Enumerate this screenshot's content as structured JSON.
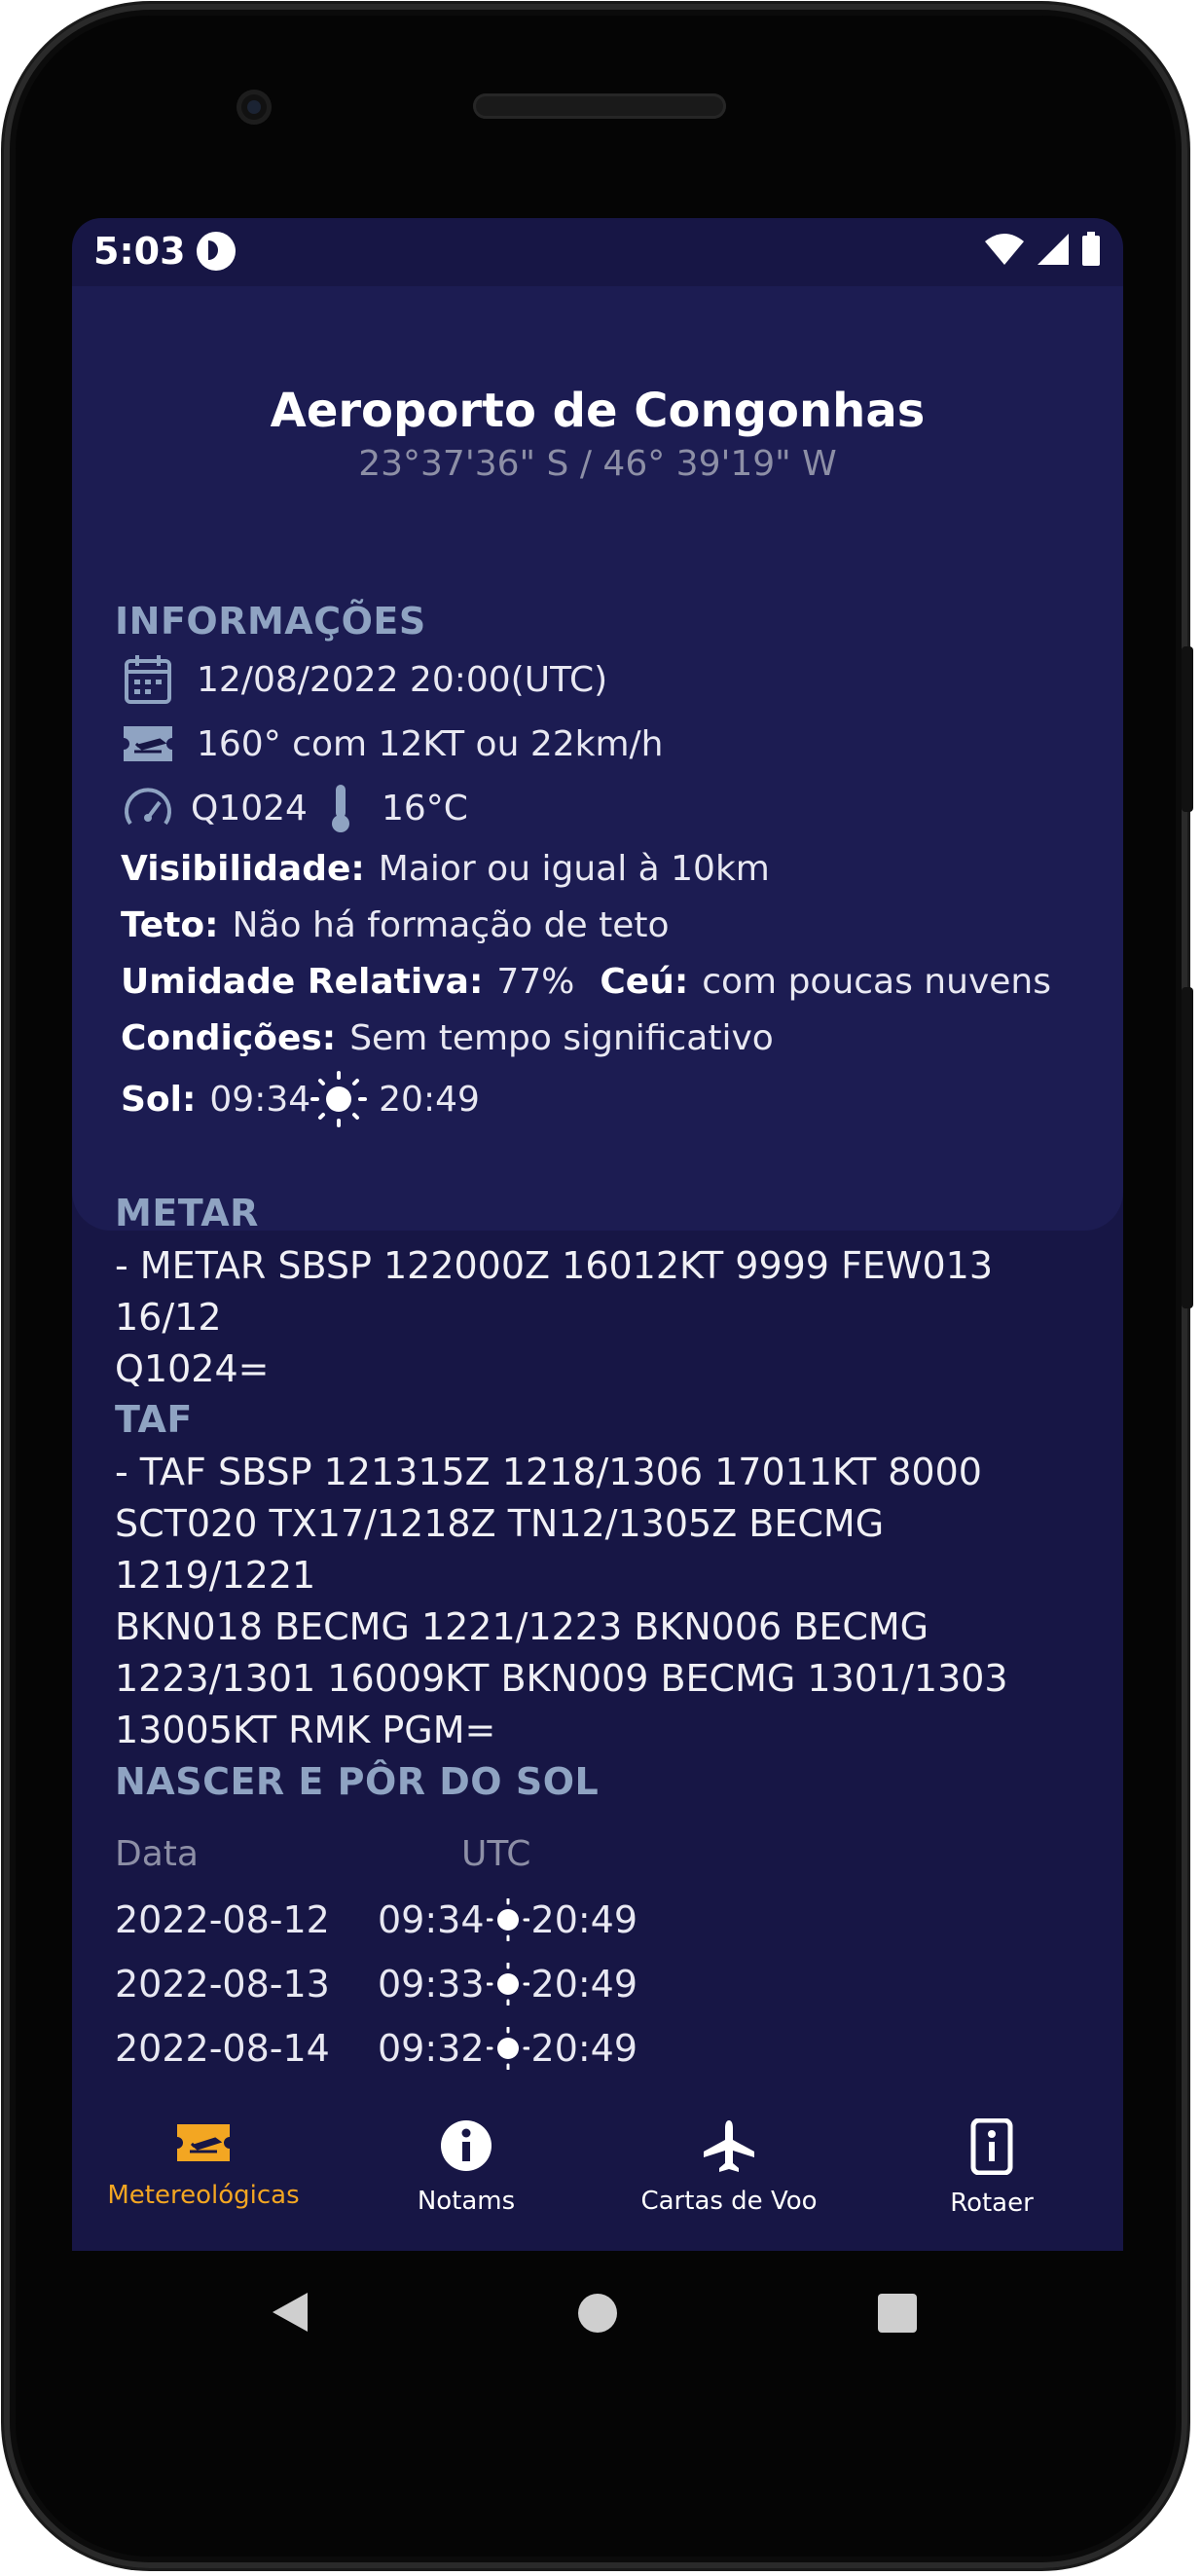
{
  "status_bar": {
    "time": "5:03"
  },
  "header": {
    "title": "Aeroporto de Congonhas",
    "coordinates": "23°37'36\" S / 46° 39'19\" W"
  },
  "info": {
    "section_label": "INFORMAÇÕES",
    "datetime": "12/08/2022 20:00(UTC)",
    "wind": "160° com 12KT ou 22km/h",
    "pressure": "Q1024",
    "temperature": "16°C",
    "visibility_label": "Visibilidade:",
    "visibility_value": "Maior ou igual à 10km",
    "ceiling_label": "Teto:",
    "ceiling_value": "Não há formação de teto",
    "humidity_label": "Umidade Relativa:",
    "humidity_value": "77%",
    "sky_label": "Ceú:",
    "sky_value": "com poucas nuvens",
    "conditions_label": "Condições:",
    "conditions_value": "Sem tempo significativo",
    "sun_label": "Sol:",
    "sunrise": "09:34",
    "sunset": "20:49"
  },
  "metar": {
    "section_label": "METAR",
    "line1": "- METAR SBSP 122000Z 16012KT 9999 FEW013 16/12",
    "line2": "Q1024="
  },
  "taf": {
    "section_label": "TAF",
    "lines": [
      "- TAF SBSP 121315Z 1218/1306 17011KT 8000",
      "SCT020 TX17/1218Z TN12/1305Z BECMG 1219/1221",
      "BKN018 BECMG 1221/1223 BKN006 BECMG",
      "1223/1301 16009KT BKN009 BECMG 1301/1303",
      "13005KT RMK PGM="
    ]
  },
  "sun_table": {
    "section_label": "NASCER E PÔR DO SOL",
    "col_date": "Data",
    "col_utc": "UTC",
    "rows": [
      {
        "date": "2022-08-12",
        "rise": "09:34",
        "set": "20:49"
      },
      {
        "date": "2022-08-13",
        "rise": "09:33",
        "set": "20:49"
      },
      {
        "date": "2022-08-14",
        "rise": "09:32",
        "set": "20:49"
      }
    ]
  },
  "bottom_nav": {
    "items": [
      {
        "label": "Metereológicas",
        "icon": "ticket-plane-icon",
        "active": true
      },
      {
        "label": "Notams",
        "icon": "info-circle-icon",
        "active": false
      },
      {
        "label": "Cartas de Voo",
        "icon": "airplane-icon",
        "active": false
      },
      {
        "label": "Rotaer",
        "icon": "phone-info-icon",
        "active": false
      }
    ],
    "active_color": "#f3a622"
  },
  "colors": {
    "background": "#171645",
    "card": "#1c1c52",
    "section": "#8fa3c2"
  }
}
